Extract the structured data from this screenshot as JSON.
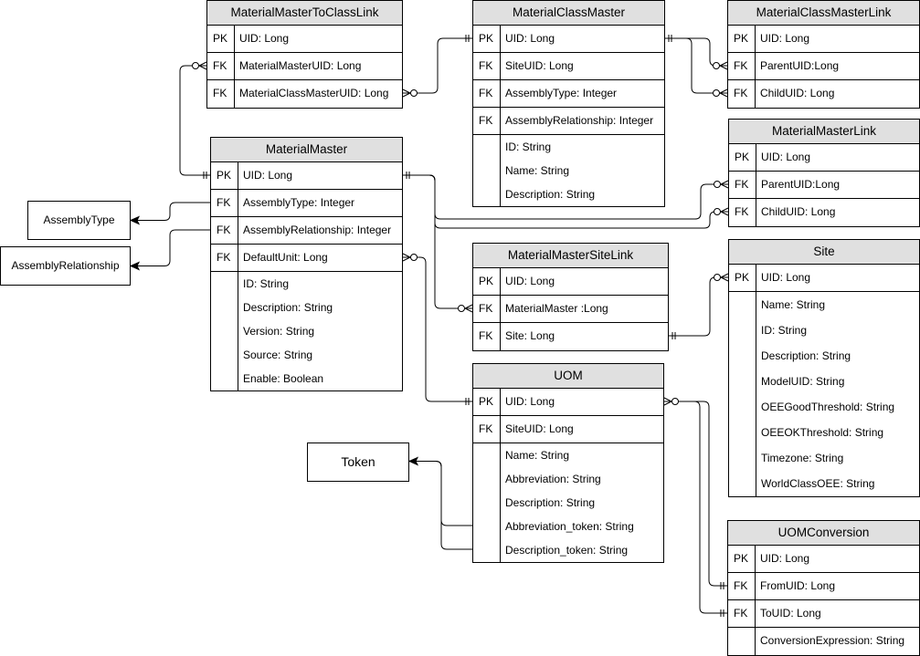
{
  "entities": [
    {
      "id": "MaterialMasterToClassLink",
      "title": "MaterialMasterToClassLink",
      "keys": [
        [
          "PK",
          "UID: Long"
        ],
        [
          "FK",
          "MaterialMasterUID: Long"
        ],
        [
          "FK",
          "MaterialClassMasterUID: Long"
        ]
      ],
      "attrs": []
    },
    {
      "id": "MaterialClassMaster",
      "title": "MaterialClassMaster",
      "keys": [
        [
          "PK",
          "UID: Long"
        ],
        [
          "FK",
          "SiteUID: Long"
        ],
        [
          "FK",
          "AssemblyType: Integer"
        ],
        [
          "FK",
          "AssemblyRelationship: Integer"
        ]
      ],
      "attrs": [
        "ID: String",
        "Name: String",
        "Description: String"
      ]
    },
    {
      "id": "MaterialClassMasterLink",
      "title": "MaterialClassMasterLink",
      "keys": [
        [
          "PK",
          "UID: Long"
        ],
        [
          "FK",
          "ParentUID:Long"
        ],
        [
          "FK",
          "ChildUID: Long"
        ]
      ],
      "attrs": []
    },
    {
      "id": "MaterialMasterLink",
      "title": "MaterialMasterLink",
      "keys": [
        [
          "PK",
          "UID: Long"
        ],
        [
          "FK",
          "ParentUID:Long"
        ],
        [
          "FK",
          "ChildUID: Long"
        ]
      ],
      "attrs": []
    },
    {
      "id": "MaterialMaster",
      "title": "MaterialMaster",
      "keys": [
        [
          "PK",
          "UID: Long"
        ],
        [
          "FK",
          "AssemblyType: Integer"
        ],
        [
          "FK",
          "AssemblyRelationship: Integer"
        ],
        [
          "FK",
          "DefaultUnit: Long"
        ]
      ],
      "attrs": [
        "ID: String",
        "Description: String",
        "Version: String",
        "Source: String",
        "Enable: Boolean"
      ]
    },
    {
      "id": "MaterialMasterSiteLink",
      "title": "MaterialMasterSiteLink",
      "keys": [
        [
          "PK",
          "UID: Long"
        ],
        [
          "FK",
          "MaterialMaster :Long"
        ],
        [
          "FK",
          "Site: Long"
        ]
      ],
      "attrs": []
    },
    {
      "id": "Site",
      "title": "Site",
      "keys": [
        [
          "PK",
          "UID: Long"
        ]
      ],
      "attrs": [
        "Name: String",
        "ID: String",
        "Description: String",
        "ModelUID: String",
        "OEEGoodThreshold: String",
        "OEEOKThreshold: String",
        "Timezone: String",
        "WorldClassOEE: String"
      ]
    },
    {
      "id": "UOM",
      "title": "UOM",
      "keys": [
        [
          "PK",
          "UID: Long"
        ],
        [
          "FK",
          "SiteUID: Long"
        ]
      ],
      "attrs": [
        "Name: String",
        "Abbreviation: String",
        "Description: String",
        "Abbreviation_token: String",
        "Description_token: String"
      ]
    },
    {
      "id": "UOMConversion",
      "title": "UOMConversion",
      "keys": [
        [
          "PK",
          "UID: Long"
        ],
        [
          "FK",
          "FromUID: Long"
        ],
        [
          "FK",
          "ToUID: Long"
        ],
        [
          "",
          "ConversionExpression: String"
        ]
      ],
      "attrs": []
    }
  ],
  "simple_boxes": [
    {
      "id": "AssemblyType",
      "label": "AssemblyType"
    },
    {
      "id": "AssemblyRelationship",
      "label": "AssemblyRelationship"
    },
    {
      "id": "Token",
      "label": "Token"
    }
  ],
  "relationships": [
    {
      "from": "MaterialMaster.UID",
      "to": "MaterialMasterToClassLink.MaterialMasterUID",
      "from_end": "one-mandatory",
      "to_end": "zero-or-many"
    },
    {
      "from": "MaterialClassMaster.UID",
      "to": "MaterialMasterToClassLink.MaterialClassMasterUID",
      "from_end": "one-mandatory",
      "to_end": "zero-or-many"
    },
    {
      "from": "MaterialClassMaster.UID",
      "to": "MaterialClassMasterLink.ParentUID",
      "from_end": "one-mandatory",
      "to_end": "zero-or-many"
    },
    {
      "from": "MaterialClassMaster.UID",
      "to": "MaterialClassMasterLink.ChildUID",
      "from_end": "one-mandatory",
      "to_end": "zero-or-many"
    },
    {
      "from": "MaterialMaster.UID",
      "to": "MaterialMasterLink.ParentUID",
      "from_end": "one-mandatory",
      "to_end": "zero-or-many"
    },
    {
      "from": "MaterialMaster.UID",
      "to": "MaterialMasterLink.ChildUID",
      "from_end": "one-mandatory",
      "to_end": "zero-or-many"
    },
    {
      "from": "MaterialMaster.UID",
      "to": "MaterialMasterSiteLink.MaterialMaster",
      "from_end": "one-mandatory",
      "to_end": "zero-or-many"
    },
    {
      "from": "MaterialMasterSiteLink.Site",
      "to": "Site.UID",
      "from_end": "one-mandatory",
      "to_end": "zero-or-many"
    },
    {
      "from": "MaterialMaster.DefaultUnit",
      "to": "UOM.UID",
      "from_end": "zero-or-many",
      "to_end": "one-mandatory"
    },
    {
      "from": "UOM.UID",
      "to": "UOMConversion.FromUID",
      "from_end": "zero-or-many",
      "to_end": "one-mandatory"
    },
    {
      "from": "UOM.UID",
      "to": "UOMConversion.ToUID",
      "from_end": "zero-or-many",
      "to_end": "one-mandatory"
    },
    {
      "from": "MaterialMaster.AssemblyType",
      "to": "AssemblyType",
      "from_end": "none",
      "to_end": "arrow"
    },
    {
      "from": "MaterialMaster.AssemblyRelationship",
      "to": "AssemblyRelationship",
      "from_end": "none",
      "to_end": "arrow"
    },
    {
      "from": "UOM.Abbreviation_token",
      "to": "Token",
      "from_end": "none",
      "to_end": "arrow"
    },
    {
      "from": "UOM.Description_token",
      "to": "Token",
      "from_end": "none",
      "to_end": "arrow"
    }
  ]
}
